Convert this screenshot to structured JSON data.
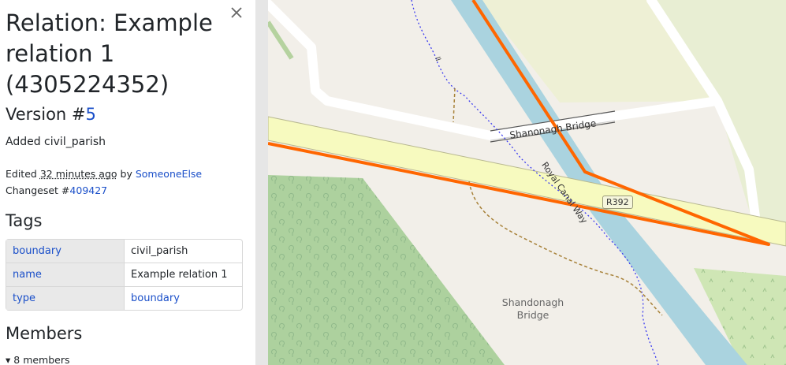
{
  "sidebar": {
    "title": "Relation: Example relation 1 (4305224352)",
    "version_prefix": "Version #",
    "version_number": "5",
    "comment": "Added civil_parish",
    "edited_prefix": "Edited",
    "edited_time": "32 minutes ago",
    "edited_by_prefix": "by",
    "user": "SomeoneElse",
    "changeset_prefix": "Changeset #",
    "changeset_id": "409427",
    "tags_heading": "Tags",
    "tags": [
      {
        "key": "boundary",
        "value": "civil_parish"
      },
      {
        "key": "name",
        "value": "Example relation 1"
      },
      {
        "key": "type",
        "value": "boundary"
      }
    ],
    "members_heading": "Members",
    "members_toggle": "8 members"
  },
  "map": {
    "bridge_label": "Shanonagh Bridge",
    "canal_way_label": "Royal Canal Way",
    "road_ref": "R392",
    "path_label": "ll",
    "place_label_line1": "Shandonagh",
    "place_label_line2": "Bridge"
  },
  "colors": {
    "boundary": "#ff6600",
    "link": "#1a4fc9",
    "water": "#aad3df",
    "road": "#f7fabf",
    "forest": "#add19e"
  }
}
